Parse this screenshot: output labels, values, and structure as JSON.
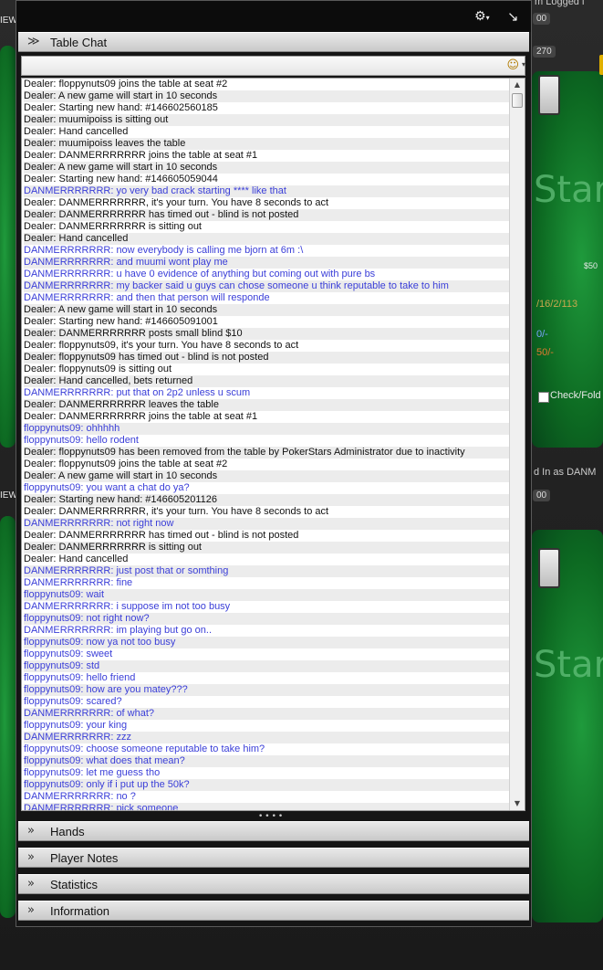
{
  "background": {
    "stars_text": "Star",
    "seat_amount": "$50",
    "counter_270": "270",
    "counter_00a": "00",
    "counter_00b": "00",
    "stats": "/16/2/113",
    "stat_row2": "0/-",
    "stat_row3": "50/-",
    "checkbox_label": "Check/Fold",
    "logged_in_text": "d In as DANM",
    "top_right_text": "m   Logged i",
    "left_edge_1": "IEW",
    "left_edge_2": "IEW"
  },
  "panel": {
    "gear_icon": "gear-icon",
    "undock_icon": "undock-arrow-icon",
    "table_chat_title": "Table Chat",
    "sections": [
      {
        "title": "Hands"
      },
      {
        "title": "Player Notes"
      },
      {
        "title": "Statistics"
      },
      {
        "title": "Information"
      }
    ]
  },
  "chat_input": {
    "value": "",
    "emoji_icon": "smiley-icon"
  },
  "chat_lines": [
    {
      "text": "Dealer: floppynuts09 joins the table at seat #2",
      "kind": "dealer"
    },
    {
      "text": "Dealer: A new game will start in 10 seconds",
      "kind": "dealer"
    },
    {
      "text": "Dealer: Starting new hand: #146602560185",
      "kind": "dealer"
    },
    {
      "text": "Dealer: muumipoiss is sitting out",
      "kind": "dealer"
    },
    {
      "text": "Dealer: Hand cancelled",
      "kind": "dealer"
    },
    {
      "text": "Dealer: muumipoiss leaves the table",
      "kind": "dealer"
    },
    {
      "text": "Dealer: DANMERRRRRRR joins the table at seat #1",
      "kind": "dealer"
    },
    {
      "text": "Dealer: A new game will start in 10 seconds",
      "kind": "dealer"
    },
    {
      "text": "Dealer: Starting new hand: #146605059044",
      "kind": "dealer"
    },
    {
      "text": "DANMERRRRRRR: yo very bad crack starting **** like that",
      "kind": "player"
    },
    {
      "text": "Dealer: DANMERRRRRRR, it's your turn. You have 8 seconds to act",
      "kind": "dealer"
    },
    {
      "text": "Dealer: DANMERRRRRRR has timed out - blind is not posted",
      "kind": "dealer"
    },
    {
      "text": "Dealer: DANMERRRRRRR is sitting out",
      "kind": "dealer"
    },
    {
      "text": "Dealer: Hand cancelled",
      "kind": "dealer"
    },
    {
      "text": "DANMERRRRRRR: now everybody is calling me bjorn at 6m :\\",
      "kind": "player"
    },
    {
      "text": "DANMERRRRRRR: and muumi wont play me",
      "kind": "player"
    },
    {
      "text": "DANMERRRRRRR: u have 0 evidence of anything but coming out with pure bs",
      "kind": "player"
    },
    {
      "text": "DANMERRRRRRR: my backer said u guys can chose someone u think reputable to take to him",
      "kind": "player"
    },
    {
      "text": "DANMERRRRRRR: and then that person will responde",
      "kind": "player"
    },
    {
      "text": "Dealer: A new game will start in 10 seconds",
      "kind": "dealer"
    },
    {
      "text": "Dealer: Starting new hand: #146605091001",
      "kind": "dealer"
    },
    {
      "text": "Dealer: DANMERRRRRRR posts small blind $10",
      "kind": "dealer"
    },
    {
      "text": "Dealer: floppynuts09, it's your turn. You have 8 seconds to act",
      "kind": "dealer"
    },
    {
      "text": "Dealer: floppynuts09 has timed out - blind is not posted",
      "kind": "dealer"
    },
    {
      "text": "Dealer: floppynuts09 is sitting out",
      "kind": "dealer"
    },
    {
      "text": "Dealer: Hand cancelled, bets returned",
      "kind": "dealer"
    },
    {
      "text": "DANMERRRRRRR: put that on 2p2 unless u scum",
      "kind": "player"
    },
    {
      "text": "Dealer: DANMERRRRRRR leaves the table",
      "kind": "dealer"
    },
    {
      "text": "Dealer: DANMERRRRRRR joins the table at seat #1",
      "kind": "dealer"
    },
    {
      "text": "floppynuts09: ohhhhh",
      "kind": "player"
    },
    {
      "text": "floppynuts09: hello rodent",
      "kind": "player"
    },
    {
      "text": "Dealer: floppynuts09 has been removed from the table by PokerStars Administrator due to inactivity",
      "kind": "dealer"
    },
    {
      "text": "Dealer: floppynuts09 joins the table at seat #2",
      "kind": "dealer"
    },
    {
      "text": "Dealer: A new game will start in 10 seconds",
      "kind": "dealer"
    },
    {
      "text": "floppynuts09: you want a chat do ya?",
      "kind": "player"
    },
    {
      "text": "Dealer: Starting new hand: #146605201126",
      "kind": "dealer"
    },
    {
      "text": "Dealer: DANMERRRRRRR, it's your turn. You have 8 seconds to act",
      "kind": "dealer"
    },
    {
      "text": "DANMERRRRRRR: not right now",
      "kind": "player"
    },
    {
      "text": "Dealer: DANMERRRRRRR has timed out - blind is not posted",
      "kind": "dealer"
    },
    {
      "text": "Dealer: DANMERRRRRRR is sitting out",
      "kind": "dealer"
    },
    {
      "text": "Dealer: Hand cancelled",
      "kind": "dealer"
    },
    {
      "text": "DANMERRRRRRR: just post that or somthing",
      "kind": "player"
    },
    {
      "text": "DANMERRRRRRR: fine",
      "kind": "player"
    },
    {
      "text": "floppynuts09: wait",
      "kind": "player"
    },
    {
      "text": "DANMERRRRRRR: i suppose im not too busy",
      "kind": "player"
    },
    {
      "text": "floppynuts09: not right now?",
      "kind": "player"
    },
    {
      "text": "DANMERRRRRRR: im playing but go on..",
      "kind": "player"
    },
    {
      "text": "floppynuts09: now ya not too busy",
      "kind": "player"
    },
    {
      "text": "floppynuts09: sweet",
      "kind": "player"
    },
    {
      "text": "floppynuts09: std",
      "kind": "player"
    },
    {
      "text": "floppynuts09: hello friend",
      "kind": "player"
    },
    {
      "text": "floppynuts09: how are you matey???",
      "kind": "player"
    },
    {
      "text": "floppynuts09: scared?",
      "kind": "player"
    },
    {
      "text": "DANMERRRRRRR: of what?",
      "kind": "player"
    },
    {
      "text": "floppynuts09: your king",
      "kind": "player"
    },
    {
      "text": "DANMERRRRRRR: zzz",
      "kind": "player"
    },
    {
      "text": "floppynuts09: choose someone reputable to take him?",
      "kind": "player"
    },
    {
      "text": "floppynuts09: what does that mean?",
      "kind": "player"
    },
    {
      "text": "floppynuts09: let me guess tho",
      "kind": "player"
    },
    {
      "text": "floppynuts09: only if i put up the 50k?",
      "kind": "player"
    },
    {
      "text": "DANMERRRRRRR: no ?",
      "kind": "player"
    },
    {
      "text": "DANMERRRRRRR: pick someone",
      "kind": "player"
    }
  ]
}
